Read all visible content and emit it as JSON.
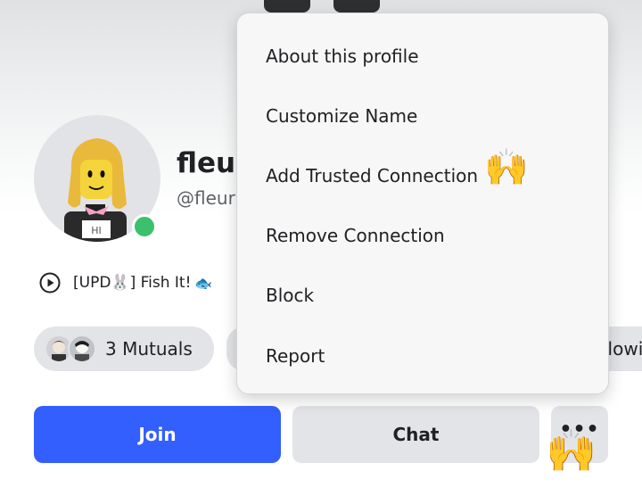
{
  "profile": {
    "display_name": "fleur",
    "username": "@fleur",
    "online_color": "#3bc06d",
    "avatar_text": "HI"
  },
  "experience": {
    "icon": "play-circle-icon",
    "label": "[UPD🐰] Fish It!",
    "emoji": "🐟"
  },
  "connections": {
    "mutuals_label": "3 Mutuals",
    "following_label": "llowi"
  },
  "actions": {
    "join_label": "Join",
    "chat_label": "Chat",
    "more_label": "•••",
    "join_color": "#335fff"
  },
  "menu": {
    "items": [
      {
        "label": "About this profile"
      },
      {
        "label": "Customize Name"
      },
      {
        "label": "Add Trusted Connection"
      },
      {
        "label": "Remove Connection"
      },
      {
        "label": "Block"
      },
      {
        "label": "Report"
      }
    ]
  },
  "overlay": {
    "wave_emoji": "🙌"
  }
}
